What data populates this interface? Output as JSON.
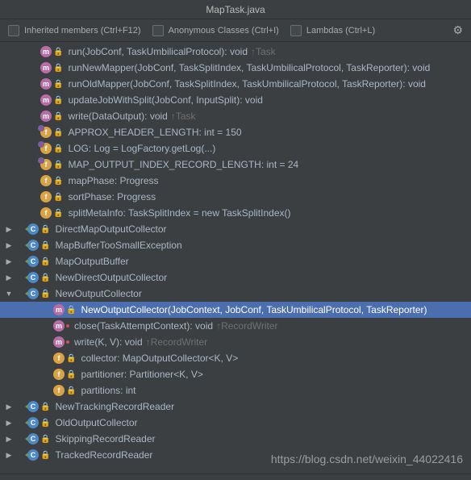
{
  "title": "MapTask.java",
  "toolbar": {
    "inherited": "Inherited members (Ctrl+F12)",
    "anon": "Anonymous Classes (Ctrl+I)",
    "lambdas": "Lambdas (Ctrl+L)"
  },
  "watermark": "https://blog.csdn.net/weixin_44022416",
  "rows": [
    {
      "depth": 2,
      "arrow": "",
      "icon": "m",
      "lock": true,
      "sig": "run(JobConf, TaskUmbilicalProtocol): void",
      "override": "↑Task"
    },
    {
      "depth": 2,
      "arrow": "",
      "icon": "m",
      "lock": true,
      "sig": "runNewMapper(JobConf, TaskSplitIndex, TaskUmbilicalProtocol, TaskReporter): void"
    },
    {
      "depth": 2,
      "arrow": "",
      "icon": "m",
      "lock": true,
      "sig": "runOldMapper(JobConf, TaskSplitIndex, TaskUmbilicalProtocol, TaskReporter): void"
    },
    {
      "depth": 2,
      "arrow": "",
      "icon": "m",
      "lock": true,
      "sig": "updateJobWithSplit(JobConf, InputSplit): void"
    },
    {
      "depth": 2,
      "arrow": "",
      "icon": "m",
      "lock": true,
      "sig": "write(DataOutput): void",
      "override": "↑Task"
    },
    {
      "depth": 2,
      "arrow": "",
      "icon": "sf",
      "lock": true,
      "sig": "APPROX_HEADER_LENGTH: int = 150"
    },
    {
      "depth": 2,
      "arrow": "",
      "icon": "sf",
      "lock": true,
      "sig": "LOG: Log = LogFactory.getLog(...)"
    },
    {
      "depth": 2,
      "arrow": "",
      "icon": "sf",
      "lock": true,
      "sig": "MAP_OUTPUT_INDEX_RECORD_LENGTH: int = 24"
    },
    {
      "depth": 2,
      "arrow": "",
      "icon": "f",
      "lock": true,
      "sig": "mapPhase: Progress"
    },
    {
      "depth": 2,
      "arrow": "",
      "icon": "f",
      "lock": true,
      "sig": "sortPhase: Progress"
    },
    {
      "depth": 2,
      "arrow": "",
      "icon": "f",
      "lock": true,
      "sig": "splitMetaInfo: TaskSplitIndex = new TaskSplitIndex()"
    },
    {
      "depth": 1,
      "arrow": "right",
      "icon": "cls",
      "lock": true,
      "sig": "DirectMapOutputCollector"
    },
    {
      "depth": 1,
      "arrow": "right",
      "icon": "cls",
      "lock": true,
      "sig": "MapBufferTooSmallException"
    },
    {
      "depth": 1,
      "arrow": "right",
      "icon": "cls",
      "lock": true,
      "sig": "MapOutputBuffer"
    },
    {
      "depth": 1,
      "arrow": "right",
      "icon": "cls",
      "lock": true,
      "sig": "NewDirectOutputCollector"
    },
    {
      "depth": 1,
      "arrow": "down",
      "icon": "cls",
      "lock": true,
      "sig": "NewOutputCollector"
    },
    {
      "depth": 3,
      "arrow": "",
      "icon": "m",
      "lock": true,
      "sig": "NewOutputCollector(JobContext, JobConf, TaskUmbilicalProtocol, TaskReporter)",
      "selected": true
    },
    {
      "depth": 3,
      "arrow": "",
      "icon": "m",
      "dot": true,
      "sig": "close(TaskAttemptContext): void",
      "override": "↑RecordWriter"
    },
    {
      "depth": 3,
      "arrow": "",
      "icon": "m",
      "dot": true,
      "sig": "write(K, V): void",
      "override": "↑RecordWriter"
    },
    {
      "depth": 3,
      "arrow": "",
      "icon": "f",
      "lock": true,
      "sig": "collector: MapOutputCollector<K, V>"
    },
    {
      "depth": 3,
      "arrow": "",
      "icon": "f",
      "lock": true,
      "sig": "partitioner: Partitioner<K, V>"
    },
    {
      "depth": 3,
      "arrow": "",
      "icon": "f",
      "lock": true,
      "sig": "partitions: int"
    },
    {
      "depth": 1,
      "arrow": "right",
      "icon": "cls",
      "lock": true,
      "sig": "NewTrackingRecordReader"
    },
    {
      "depth": 1,
      "arrow": "right",
      "icon": "cls",
      "lock": true,
      "sig": "OldOutputCollector"
    },
    {
      "depth": 1,
      "arrow": "right",
      "icon": "cls",
      "lock": true,
      "sig": "SkippingRecordReader"
    },
    {
      "depth": 1,
      "arrow": "right",
      "icon": "cls",
      "lock": true,
      "sig": "TrackedRecordReader"
    }
  ]
}
